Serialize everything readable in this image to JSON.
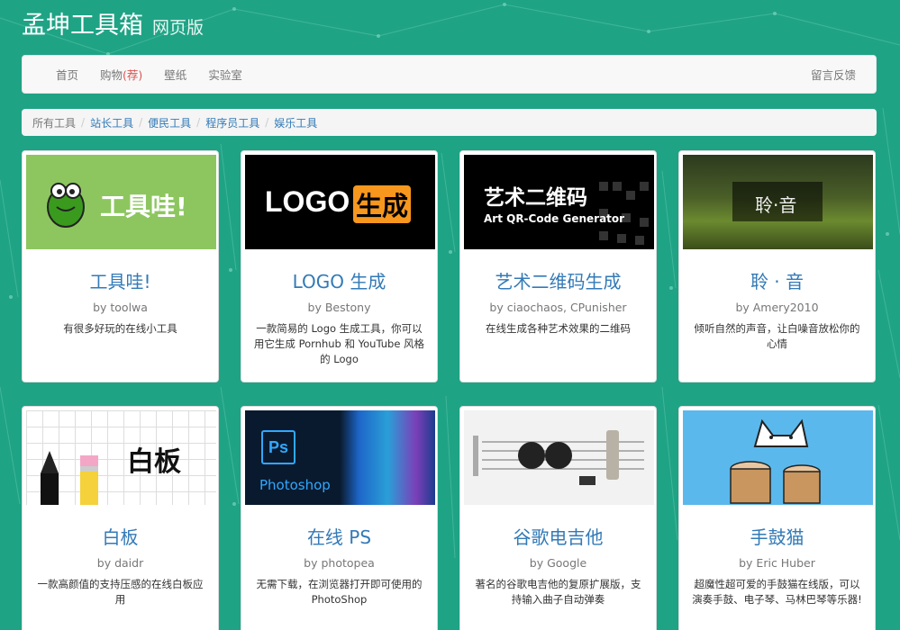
{
  "header": {
    "title": "孟坤工具箱",
    "subtitle": "网页版"
  },
  "nav": {
    "items": [
      {
        "label": "首页"
      },
      {
        "label": "购物",
        "badge": "(荐)"
      },
      {
        "label": "壁纸"
      },
      {
        "label": "实验室"
      }
    ],
    "feedback": "留言反馈"
  },
  "breadcrumb": [
    "所有工具",
    "站长工具",
    "便民工具",
    "程序员工具",
    "娱乐工具"
  ],
  "cards": [
    {
      "title": "工具哇!",
      "author": "by toolwa",
      "desc": "有很多好玩的在线小工具",
      "thumb_text": "工具哇!"
    },
    {
      "title": "LOGO 生成",
      "author": "by Bestony",
      "desc": "一款简易的 Logo 生成工具，你可以用它生成 Pornhub 和 YouTube 风格的 Logo",
      "thumb_text_a": "LOGO",
      "thumb_text_b": "生成"
    },
    {
      "title": "艺术二维码生成",
      "author": "by ciaochaos, CPunisher",
      "desc": "在线生成各种艺术效果的二维码",
      "thumb_text_a": "艺术二维码",
      "thumb_text_b": "Art QR-Code Generator"
    },
    {
      "title": "聆 · 音",
      "author": "by Amery2010",
      "desc": "倾听自然的声音，让白噪音放松你的心情",
      "thumb_text": "聆·音"
    },
    {
      "title": "白板",
      "author": "by daidr",
      "desc": "一款高颜值的支持压感的在线白板应用",
      "thumb_text": "白板"
    },
    {
      "title": "在线 PS",
      "author": "by photopea",
      "desc": "无需下载，在浏览器打开即可使用的 PhotoShop",
      "thumb_text_a": "Ps",
      "thumb_text_b": "Photoshop"
    },
    {
      "title": "谷歌电吉他",
      "author": "by Google",
      "desc": "著名的谷歌电吉他的复原扩展版，支持输入曲子自动弹奏"
    },
    {
      "title": "手鼓猫",
      "author": "by Eric Huber",
      "desc": "超魔性超可爱的手鼓猫在线版，可以演奏手鼓、电子琴、马林巴琴等乐器!"
    }
  ],
  "colors": {
    "background": "#1fa385",
    "link": "#337ab7",
    "hot": "#d9534f"
  }
}
